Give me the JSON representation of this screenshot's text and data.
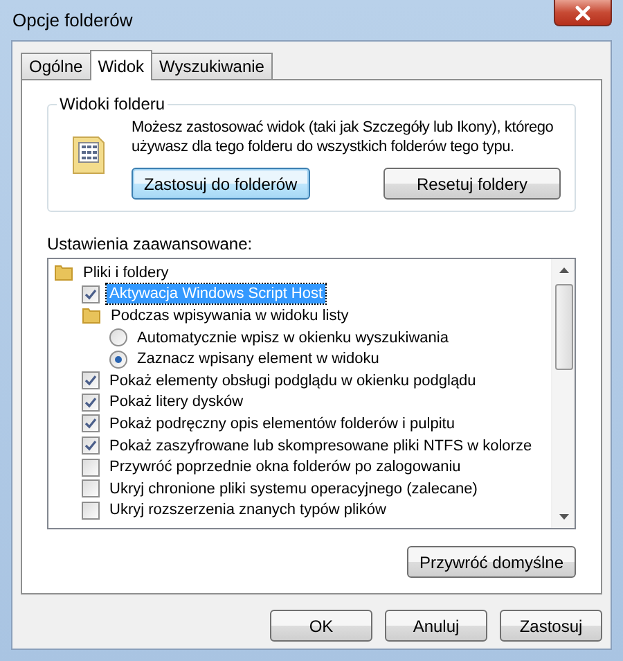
{
  "window": {
    "title": "Opcje folderów"
  },
  "tabs": [
    {
      "label": "Ogólne",
      "selected": false
    },
    {
      "label": "Widok",
      "selected": true
    },
    {
      "label": "Wyszukiwanie",
      "selected": false
    }
  ],
  "folder_views": {
    "title": "Widoki folderu",
    "description": "Możesz zastosować widok (taki jak Szczegóły lub Ikony), którego używasz dla tego folderu do wszystkich folderów tego typu.",
    "buttons": [
      {
        "label": "Zastosuj do folderów",
        "focused": true
      },
      {
        "label": "Resetuj foldery",
        "focused": false
      }
    ]
  },
  "advanced": {
    "label": "Ustawienia zaawansowane:",
    "tree": [
      {
        "kind": "folder",
        "label": "Pliki i foldery",
        "selected": false,
        "children": [
          {
            "kind": "checkbox",
            "label": "Aktywacja Windows Script Host",
            "checked": true,
            "selected": true
          },
          {
            "kind": "folder",
            "label": "Podczas wpisywania w widoku listy",
            "selected": false,
            "children": [
              {
                "kind": "radio",
                "label": "Automatycznie wpisz w okienku wyszukiwania",
                "checked": false,
                "selected": false
              },
              {
                "kind": "radio",
                "label": "Zaznacz wpisany element w widoku",
                "checked": true,
                "selected": false
              }
            ]
          },
          {
            "kind": "checkbox",
            "label": "Pokaż elementy obsługi podglądu w okienku podglądu",
            "checked": true,
            "selected": false
          },
          {
            "kind": "checkbox",
            "label": "Pokaż litery dysków",
            "checked": true,
            "selected": false
          },
          {
            "kind": "checkbox",
            "label": "Pokaż podręczny opis elementów folderów i pulpitu",
            "checked": true,
            "selected": false
          },
          {
            "kind": "checkbox",
            "label": "Pokaż zaszyfrowane lub skompresowane pliki NTFS w kolorze",
            "checked": true,
            "selected": false
          },
          {
            "kind": "checkbox",
            "label": "Przywróć poprzednie okna folderów po zalogowaniu",
            "checked": false,
            "selected": false
          },
          {
            "kind": "checkbox",
            "label": "Ukryj chronione pliki systemu operacyjnego (zalecane)",
            "checked": false,
            "selected": false
          },
          {
            "kind": "checkbox",
            "label": "Ukryj rozszerzenia znanych typów plików",
            "checked": false,
            "selected": false
          }
        ]
      }
    ],
    "restore_button": "Przywróć domyślne"
  },
  "buttons": [
    "OK",
    "Anuluj",
    "Zastosuj"
  ]
}
